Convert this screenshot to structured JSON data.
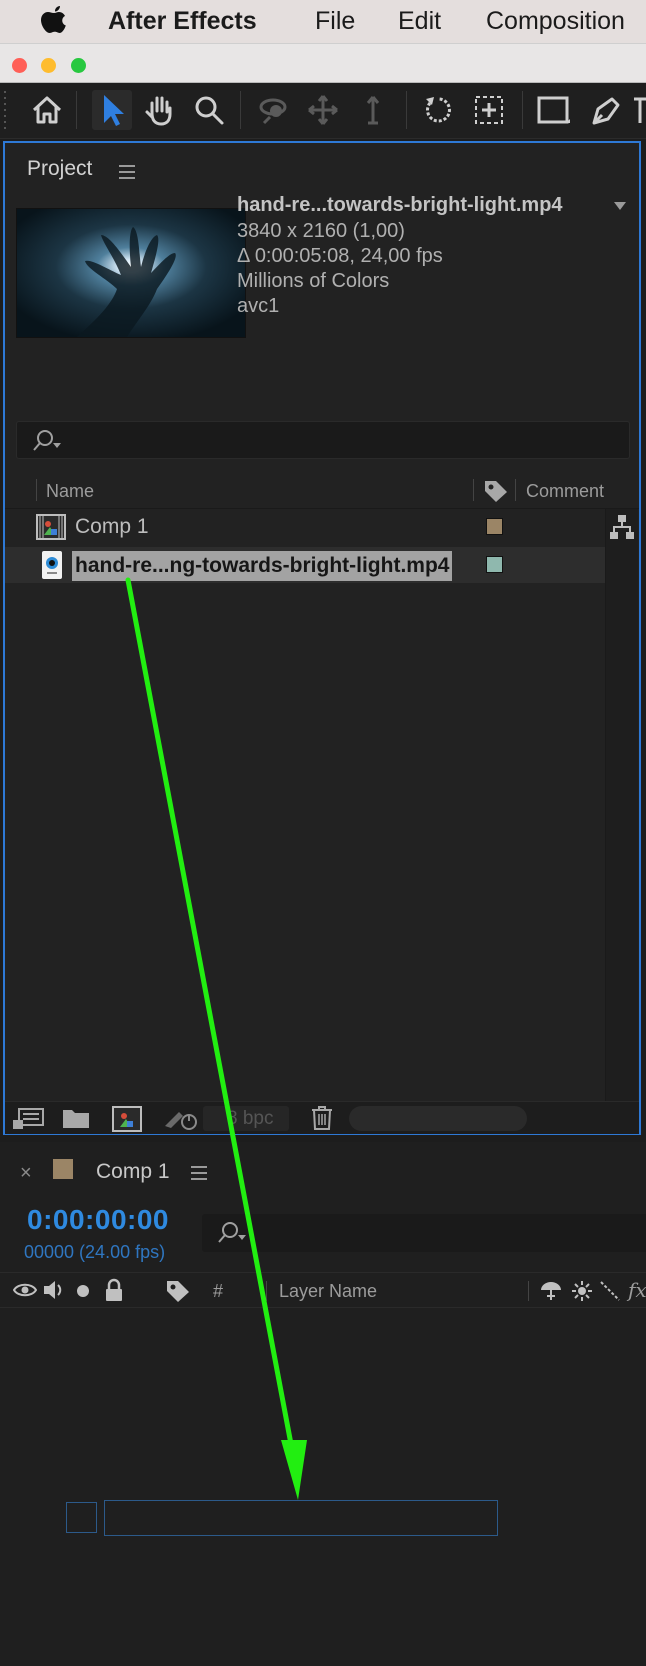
{
  "menubar": {
    "app_name": "After Effects",
    "items": [
      "File",
      "Edit",
      "Composition"
    ]
  },
  "project_panel": {
    "title": "Project",
    "selected_file": {
      "name": "hand-re...towards-bright-light.mp4",
      "dimensions": "3840 x 2160 (1,00)",
      "duration": "Δ 0:00:05:08, 24,00 fps",
      "colors": "Millions of Colors",
      "codec": "avc1"
    },
    "columns": {
      "name": "Name",
      "comment": "Comment"
    },
    "items": [
      {
        "name": "Comp 1",
        "type": "composition",
        "label_color": "#9b8566",
        "selected": false
      },
      {
        "name": "hand-re...ng-towards-bright-light.mp4",
        "type": "footage",
        "label_color": "#8fb8ae",
        "selected": true
      }
    ],
    "footer": {
      "bit_depth": "8 bpc"
    }
  },
  "comp_panel": {
    "title": "Comp 1",
    "label_color": "#9b8566",
    "timecode": "0:00:00:00",
    "frame_info": "00000 (24.00 fps)",
    "columns": {
      "number": "#",
      "layer_name": "Layer Name",
      "fx": "fx"
    }
  },
  "annotation": {
    "color": "#22ee11"
  }
}
